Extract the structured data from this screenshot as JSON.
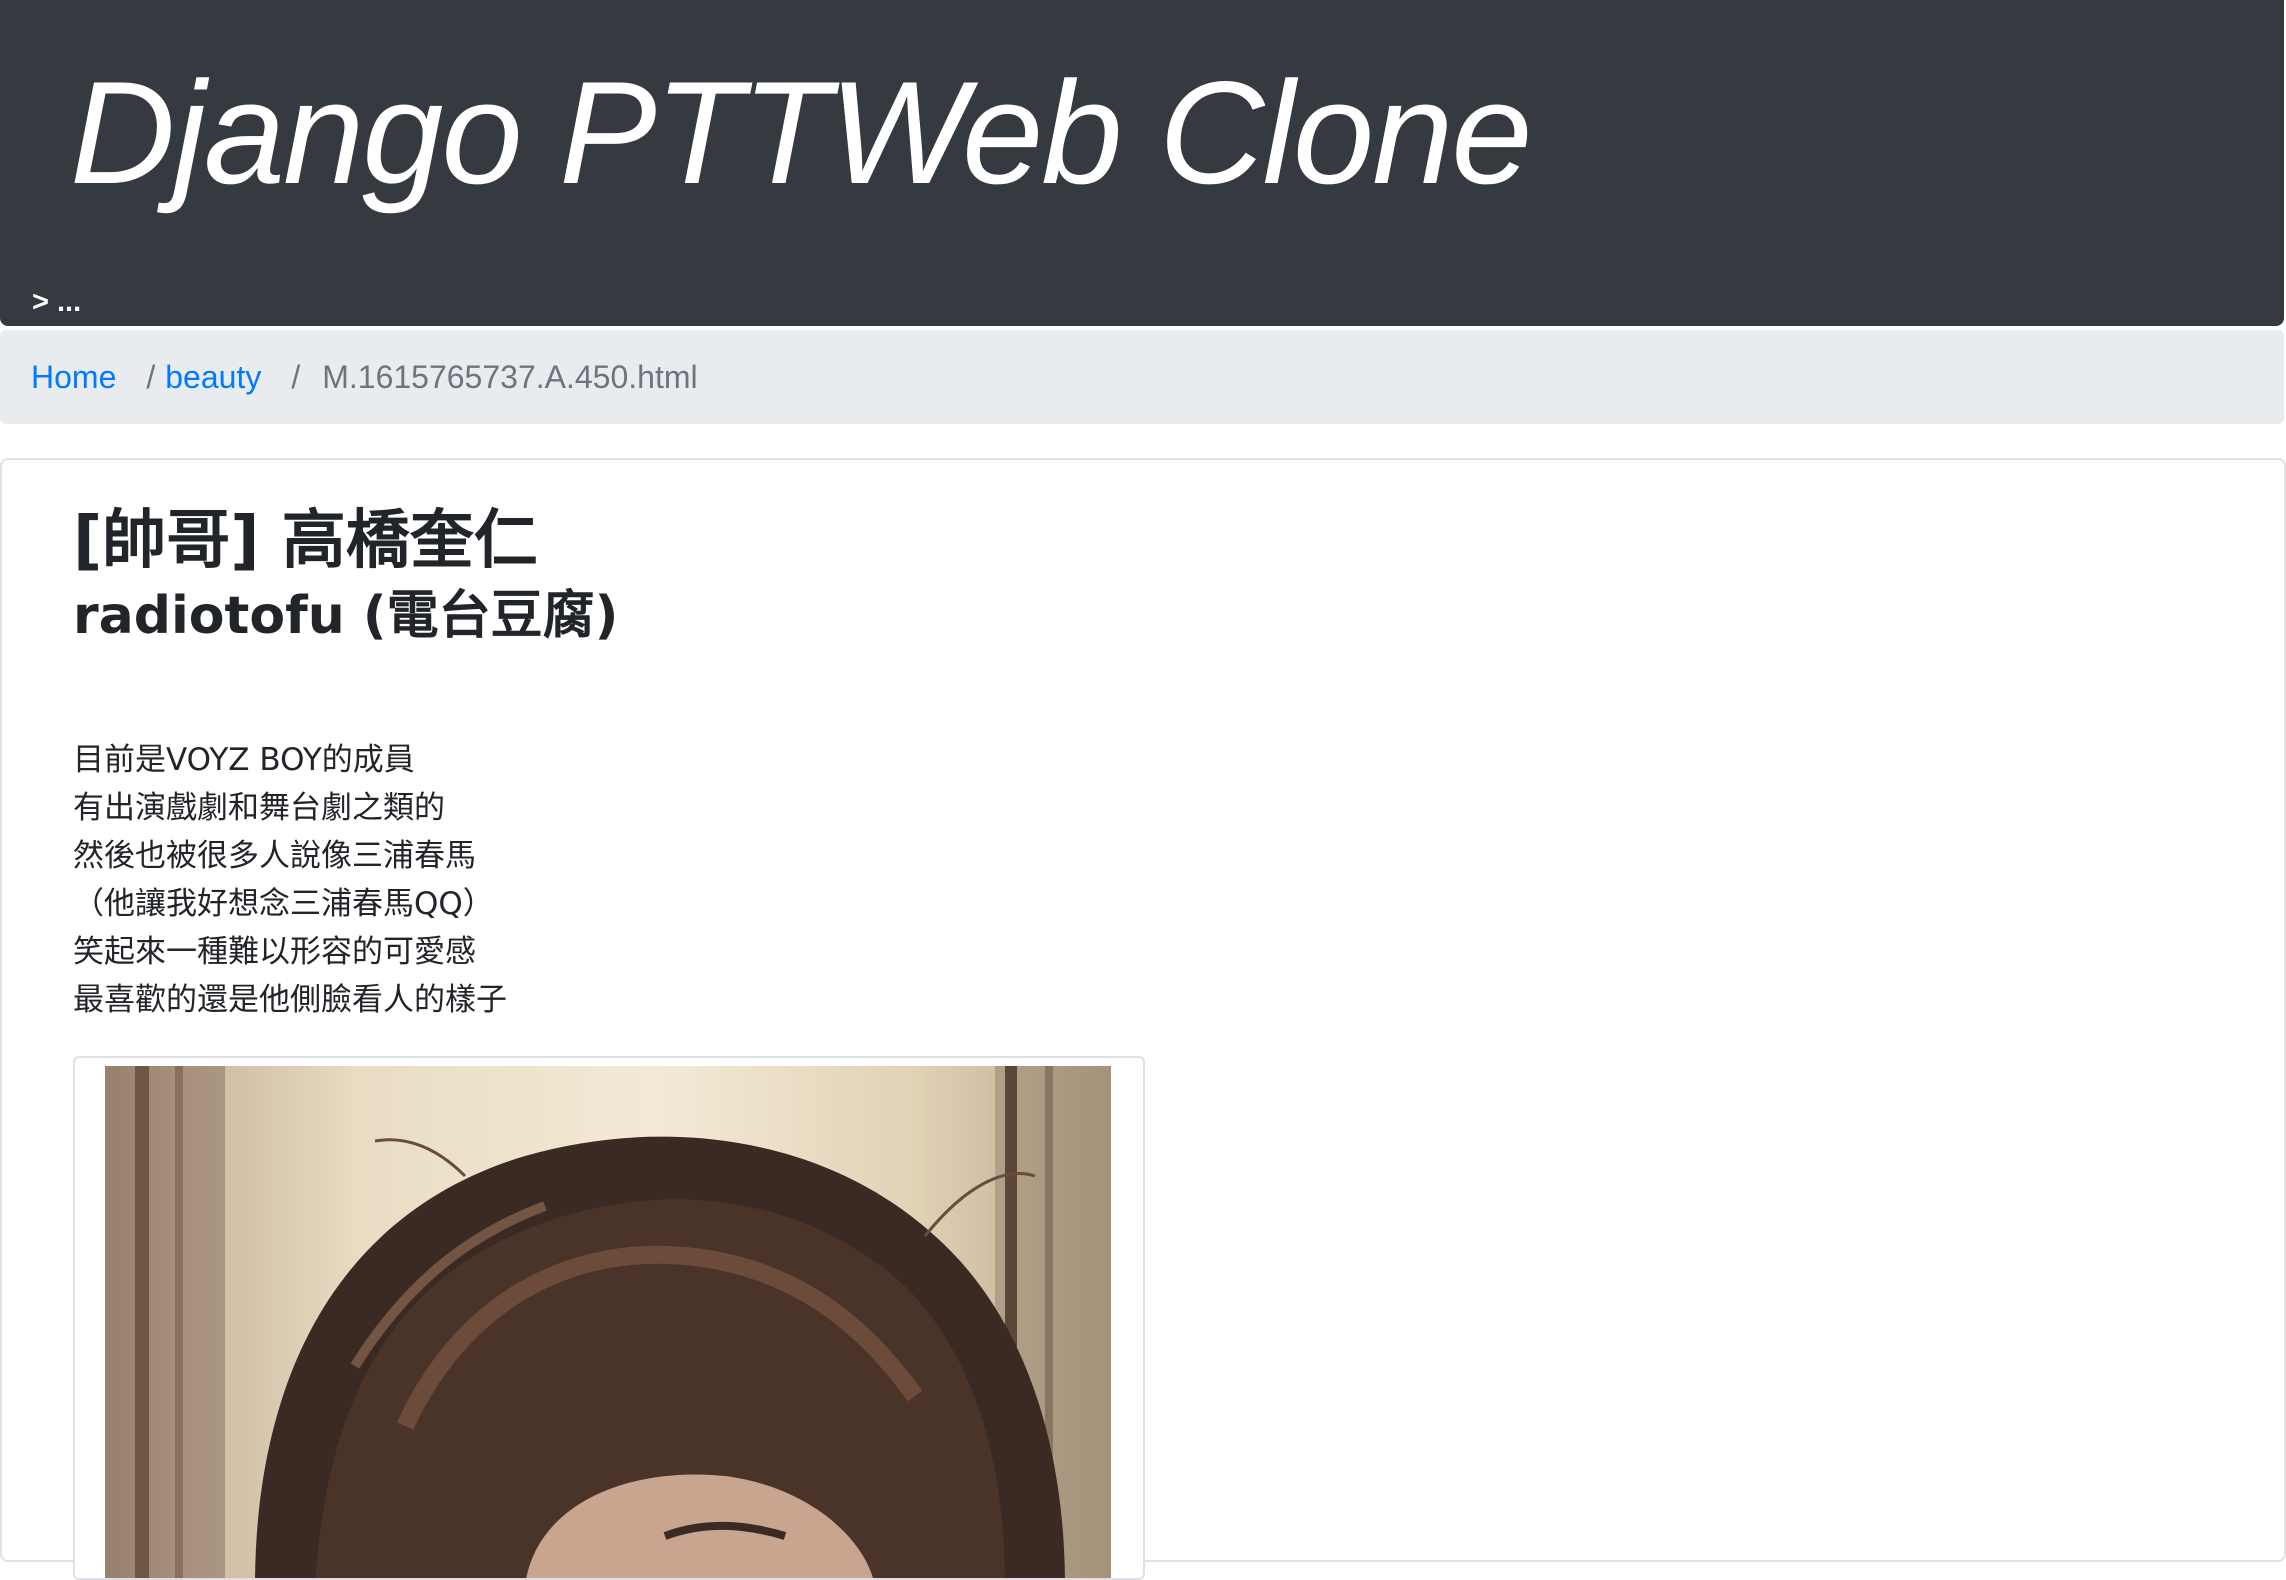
{
  "header": {
    "site_title": "Django PTTWeb Clone",
    "nav_text": "> ..."
  },
  "breadcrumb": {
    "home": "Home",
    "separator": "/",
    "board": "beauty",
    "current": "M.1615765737.A.450.html"
  },
  "post": {
    "title": "[帥哥] 高橋奎仁",
    "author": "radiotofu (電台豆腐)",
    "lines": [
      "目前是VOYZ BOY的成員",
      "有出演戲劇和舞台劇之類的",
      "然後也被很多人說像三浦春馬",
      "（他讓我好想念三浦春馬QQ）",
      "笑起來一種難以形容的可愛感",
      "最喜歡的還是他側臉看人的樣子"
    ]
  },
  "colors": {
    "header_bg": "#343a40",
    "breadcrumb_bg": "#e9ecef",
    "link": "#007bff",
    "muted": "#6c757d",
    "text": "#212529"
  }
}
